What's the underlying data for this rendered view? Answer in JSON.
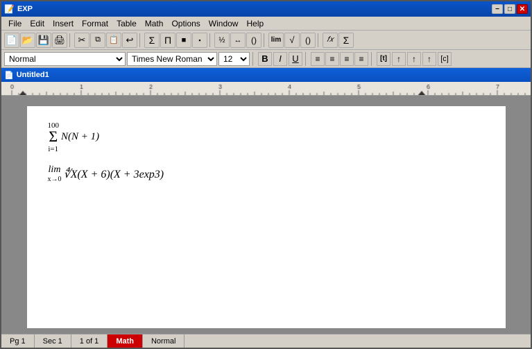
{
  "titlebar": {
    "app_title": "EXP",
    "min_label": "−",
    "max_label": "□",
    "close_label": "✕"
  },
  "menu": {
    "items": [
      "File",
      "Edit",
      "Insert",
      "Format",
      "Table",
      "Math",
      "Options",
      "Window",
      "Help"
    ]
  },
  "toolbar1": {
    "buttons": [
      "📄",
      "📂",
      "💾",
      "🖨",
      "✂",
      "📋",
      "📋",
      "↩",
      "Σ",
      "Π",
      "■",
      "▪",
      "½",
      "↔",
      "()",
      "lim",
      "√",
      "()",
      "𝑓𝑥",
      "Σ"
    ]
  },
  "toolbar2": {
    "style_value": "Normal",
    "font_value": "Times New Roman",
    "size_value": "12",
    "bold_label": "B",
    "italic_label": "I",
    "underline_label": "U",
    "align_left": "≡",
    "align_center": "≡",
    "align_right": "≡",
    "align_justify": "≡"
  },
  "document": {
    "title": "Untitled1",
    "content": {
      "expr1_top": "100",
      "expr1_sigma": "Σ",
      "expr1_bottom": "i=1",
      "expr1_body": "N(N + 1)",
      "expr2_lim": "lim",
      "expr2_sub": "x→0",
      "expr2_body": "∜X(X + 6)(X + 3exp3)"
    }
  },
  "statusbar": {
    "page": "Pg 1",
    "section": "Sec 1",
    "position": "1 of 1",
    "mode": "Math",
    "style": "Normal"
  }
}
